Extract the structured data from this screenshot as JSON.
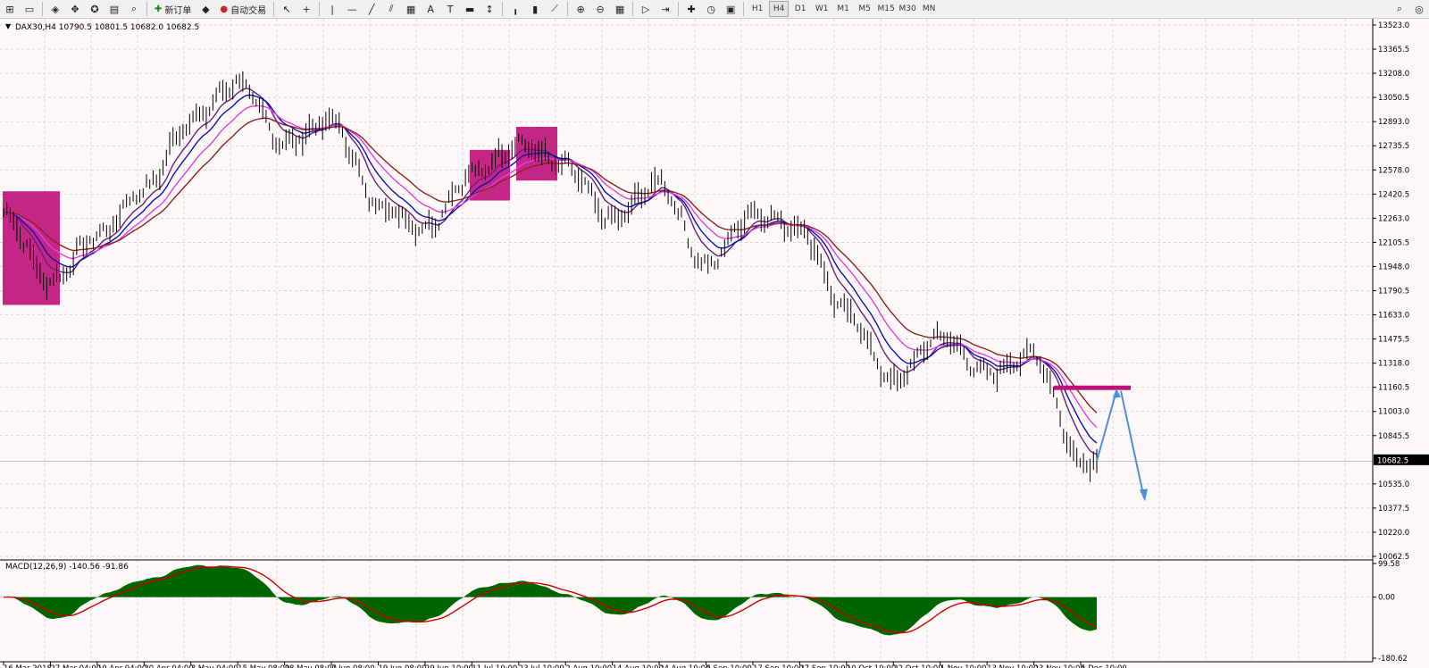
{
  "toolbar": {
    "new_order_label": "新订单",
    "auto_trading_label": "自动交易",
    "timeframes": [
      "H1",
      "H4",
      "D1",
      "W1",
      "M1",
      "M5",
      "M15",
      "M30",
      "MN"
    ]
  },
  "chart_header": {
    "symbol_info": "DAX30,H4  10790.5 10801.5 10682.0 10682.5"
  },
  "price_axis": {
    "labels": [
      "13523.0",
      "13365.5",
      "13208.0",
      "13050.5",
      "12893.0",
      "12735.5",
      "12578.0",
      "12420.5",
      "12263.0",
      "12105.5",
      "11948.0",
      "11790.5",
      "11633.0",
      "11475.5",
      "11318.0",
      "11160.5",
      "11003.0",
      "10845.5",
      "10682.5",
      "10535.0",
      "10377.5",
      "10220.0",
      "10062.5"
    ],
    "current_price": "10682.5"
  },
  "macd": {
    "label": "MACD(12,26,9) -140.56 -91.86",
    "axis_labels": [
      "99.58",
      "0.00",
      "-180.62"
    ]
  },
  "time_axis": {
    "labels": [
      "16 Mar 2018",
      "27 Mar 04:00",
      "10 Apr 04:00",
      "20 Apr 04:00",
      "3 May 04:00",
      "15 May 08:00",
      "28 May 08:00",
      "7 Jun 08:00",
      "19 Jun 08:00",
      "29 Jun 10:00",
      "11 Jul 10:00",
      "23 Jul 10:00",
      "2 Aug 10:00",
      "14 Aug 10:00",
      "24 Aug 10:00",
      "5 Sep 10:00",
      "17 Sep 10:00",
      "27 Sep 10:00",
      "10 Oct 10:00",
      "22 Oct 10:00",
      "1 Nov 10:00",
      "13 Nov 10:00",
      "23 Nov 10:00",
      "5 Dec 10:00"
    ]
  },
  "chart_data": {
    "type": "line",
    "title": "DAX30,H4",
    "x": [
      "16 Mar 2018",
      "27 Mar 04:00",
      "10 Apr 04:00",
      "20 Apr 04:00",
      "3 May 04:00",
      "15 May 08:00",
      "28 May 08:00",
      "7 Jun 08:00",
      "19 Jun 08:00",
      "29 Jun 10:00",
      "11 Jul 10:00",
      "23 Jul 10:00",
      "2 Aug 10:00",
      "14 Aug 10:00",
      "24 Aug 10:00",
      "5 Sep 10:00",
      "17 Sep 10:00",
      "27 Sep 10:00",
      "10 Oct 10:00",
      "22 Oct 10:00",
      "1 Nov 10:00",
      "13 Nov 10:00",
      "23 Nov 10:00",
      "5 Dec 10:00"
    ],
    "series": [
      {
        "values": [
          12300,
          11850,
          12150,
          12450,
          12900,
          13150,
          12750,
          12900,
          12350,
          12200,
          12550,
          12750,
          12600,
          12250,
          12500,
          11950,
          12300,
          12200,
          11650,
          11200,
          11500,
          11250,
          11380,
          10682.5
        ]
      }
    ],
    "ylim": [
      10062.5,
      13523.0
    ],
    "colors": {
      "price": "#000000",
      "ma_blue": "#0a12a8",
      "ma_purple": "#6a1f7a",
      "ma_magenta": "#e040e0",
      "ma_brown": "#8b2323",
      "box": "#c0107a",
      "arrow": "#4a90d6",
      "macd_hist": "#006400",
      "macd_signal": "#cc0000"
    }
  }
}
